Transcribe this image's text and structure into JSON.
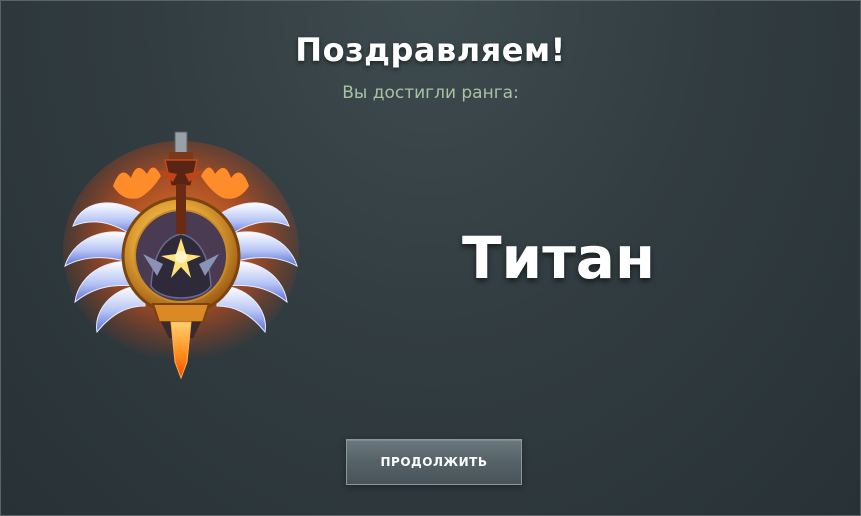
{
  "dialog": {
    "title": "Поздравляем!",
    "subtitle": "Вы достигли ранга:",
    "rank_name": "Титан",
    "continue_label": "ПРОДОЛЖИТЬ"
  },
  "medal": {
    "icon": "titan-rank-medal-icon",
    "colors": {
      "wing": "#8fa6ee",
      "glow": "#ff6a1a",
      "gold": "#e0a133",
      "blade": "#ff9a24"
    }
  }
}
